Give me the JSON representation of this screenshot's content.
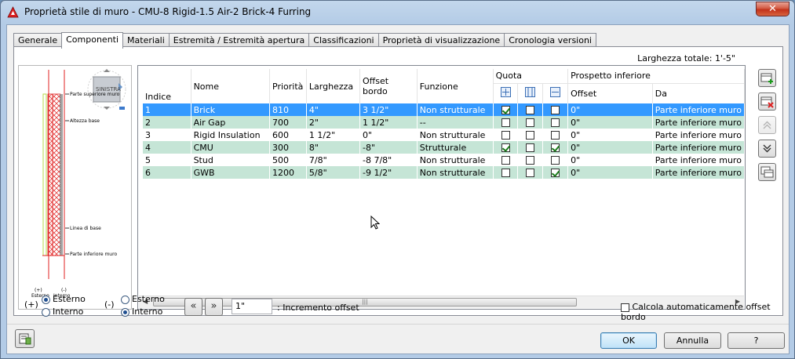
{
  "window": {
    "title": "Proprietà stile di muro - CMU-8 Rigid-1.5 Air-2 Brick-4 Furring",
    "close_label": "✕"
  },
  "tabs": [
    {
      "label": "Generale"
    },
    {
      "label": "Componenti"
    },
    {
      "label": "Materiali"
    },
    {
      "label": "Estremità / Estremità apertura"
    },
    {
      "label": "Classificazioni"
    },
    {
      "label": "Proprietà di visualizzazione"
    },
    {
      "label": "Cronologia versioni"
    }
  ],
  "active_tab": "Componenti",
  "total_width": "Larghezza totale: 1'-5\"",
  "preview": {
    "view_cube_label": "SINISTRA",
    "labels": {
      "top": "Parte superiore muro",
      "base_height": "Altezza base",
      "baseline": "Linea di base",
      "bottom": "Parte inferiore muro",
      "plus": "(+)",
      "minus": "(-)",
      "exterior": "Esterno",
      "interior": "Interno"
    }
  },
  "grid": {
    "headers": {
      "index": "Indice",
      "name": "Nome",
      "priority": "Priorità",
      "width": "Larghezza",
      "edge_offset": "Offset bordo",
      "function": "Funzione",
      "dimension": "Quota",
      "bottom_elevation": "Prospetto inferiore",
      "offset": "Offset",
      "from": "Da"
    },
    "rows": [
      {
        "index": "1",
        "name": "Brick",
        "priority": "810",
        "width": "4\"",
        "edge_offset": "3 1/2\"",
        "function": "Non strutturale",
        "q1": true,
        "q2": false,
        "q3": false,
        "offset": "0\"",
        "from": "Parte inferiore muro"
      },
      {
        "index": "2",
        "name": "Air Gap",
        "priority": "700",
        "width": "2\"",
        "edge_offset": "1 1/2\"",
        "function": "--",
        "q1": false,
        "q2": false,
        "q3": false,
        "offset": "0\"",
        "from": "Parte inferiore muro"
      },
      {
        "index": "3",
        "name": "Rigid Insulation",
        "priority": "600",
        "width": "1 1/2\"",
        "edge_offset": "0\"",
        "function": "Non strutturale",
        "q1": false,
        "q2": false,
        "q3": false,
        "offset": "0\"",
        "from": "Parte inferiore muro"
      },
      {
        "index": "4",
        "name": "CMU",
        "priority": "300",
        "width": "8\"",
        "edge_offset": "-8\"",
        "function": "Strutturale",
        "q1": true,
        "q2": false,
        "q3": true,
        "offset": "0\"",
        "from": "Parte inferiore muro"
      },
      {
        "index": "5",
        "name": "Stud",
        "priority": "500",
        "width": "7/8\"",
        "edge_offset": "-8 7/8\"",
        "function": "Non strutturale",
        "q1": false,
        "q2": false,
        "q3": false,
        "offset": "0\"",
        "from": "Parte inferiore muro"
      },
      {
        "index": "6",
        "name": "GWB",
        "priority": "1200",
        "width": "5/8\"",
        "edge_offset": "-9 1/2\"",
        "function": "Non strutturale",
        "q1": false,
        "q2": false,
        "q3": true,
        "offset": "0\"",
        "from": "Parte inferiore muro"
      }
    ]
  },
  "side_buttons": [
    "add-component-icon",
    "delete-component-icon",
    "move-up-icon",
    "move-down-icon",
    "copy-component-icon"
  ],
  "options": {
    "plus_label": "(+)",
    "minus_label": "(-)",
    "exterior": "Esterno",
    "interior": "Interno",
    "offset_value": "1\"",
    "offset_increment_label": ": Incremento offset",
    "auto_offset_label": "Calcola automaticamente offset bordo"
  },
  "buttons": {
    "ok": "OK",
    "cancel": "Annulla",
    "help": "?"
  },
  "colors": {
    "selected_row": "#3399ff",
    "alt_row": "#c5e5d6",
    "wall_hatch": "#e02020",
    "wall_insulation": "#b5d84a"
  }
}
